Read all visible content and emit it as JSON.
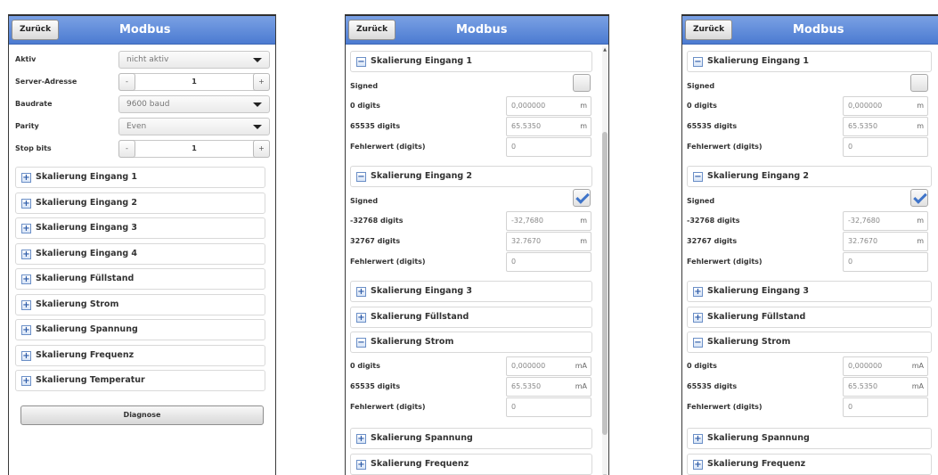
{
  "screen1": {
    "back_label": "Zurück",
    "title": "Modbus",
    "aktiv_label": "Aktiv",
    "aktiv_value": "nicht aktiv",
    "server_label": "Server-Adresse",
    "server_value": "1",
    "baud_label": "Baudrate",
    "baud_value": "9600 baud",
    "parity_label": "Parity",
    "parity_value": "Even",
    "stopbits_label": "Stop bits",
    "stopbits_value": "1",
    "minus": "-",
    "plus": "+",
    "sections": [
      "Skalierung Eingang 1",
      "Skalierung Eingang 2",
      "Skalierung Eingang 3",
      "Skalierung Eingang 4",
      "Skalierung Füllstand",
      "Skalierung Strom",
      "Skalierung Spannung",
      "Skalierung Frequenz",
      "Skalierung Temperatur"
    ],
    "diagnose_label": "Diagnose"
  },
  "screen2": {
    "back_label": "Zurück",
    "title": "Modbus",
    "sec1": "Skalierung Eingang 1",
    "sec2": "Skalierung Eingang 2",
    "sec3": "Skalierung Eingang 3",
    "sec4": "Skalierung Füllstand",
    "sec5": "Skalierung Strom",
    "sec6": "Skalierung Spannung",
    "sec7": "Skalierung Frequenz",
    "signed_label": "Signed",
    "e1_lo_label": "0 digits",
    "e1_lo_value": "0,000000",
    "e1_lo_unit": "m",
    "e1_hi_label": "65535 digits",
    "e1_hi_value": "65.5350",
    "e1_hi_unit": "m",
    "fehler_label": "Fehlerwert (digits)",
    "fehler_value": "0",
    "e2_lo_label": "-32768 digits",
    "e2_lo_value": "-32,7680",
    "e2_lo_unit": "m",
    "e2_hi_label": "32767 digits",
    "e2_hi_value": "32.7670",
    "e2_hi_unit": "m",
    "s_lo_label": "0 digits",
    "s_lo_value": "0,000000",
    "s_lo_unit": "mA",
    "s_hi_label": "65535 digits",
    "s_hi_value": "65.5350",
    "s_hi_unit": "mA",
    "scroll_up": "▲",
    "scroll_down": "▼"
  },
  "screen3": {
    "back_label": "Zurück",
    "title": "Modbus",
    "sec1": "Skalierung Eingang 1",
    "sec2": "Skalierung Eingang 2",
    "sec3": "Skalierung Eingang 3",
    "sec4": "Skalierung Füllstand",
    "sec5": "Skalierung Strom",
    "sec6": "Skalierung Spannung",
    "sec7": "Skalierung Frequenz",
    "signed_label": "Signed",
    "e1_lo_label": "0 digits",
    "e1_lo_value": "0,000000",
    "e1_lo_unit": "m",
    "e1_hi_label": "65535 digits",
    "e1_hi_value": "65.5350",
    "e1_hi_unit": "m",
    "fehler_label": "Fehlerwert (digits)",
    "fehler_value": "0",
    "e2_lo_label": "-32768 digits",
    "e2_lo_value": "-32,7680",
    "e2_lo_unit": "m",
    "e2_hi_label": "32767 digits",
    "e2_hi_value": "32.7670",
    "e2_hi_unit": "m",
    "s_lo_label": "0 digits",
    "s_lo_value": "0,000000",
    "s_lo_unit": "mA",
    "s_hi_label": "65535 digits",
    "s_hi_value": "65.5350",
    "s_hi_unit": "mA"
  },
  "toggle_plus": "+",
  "toggle_minus": "−"
}
